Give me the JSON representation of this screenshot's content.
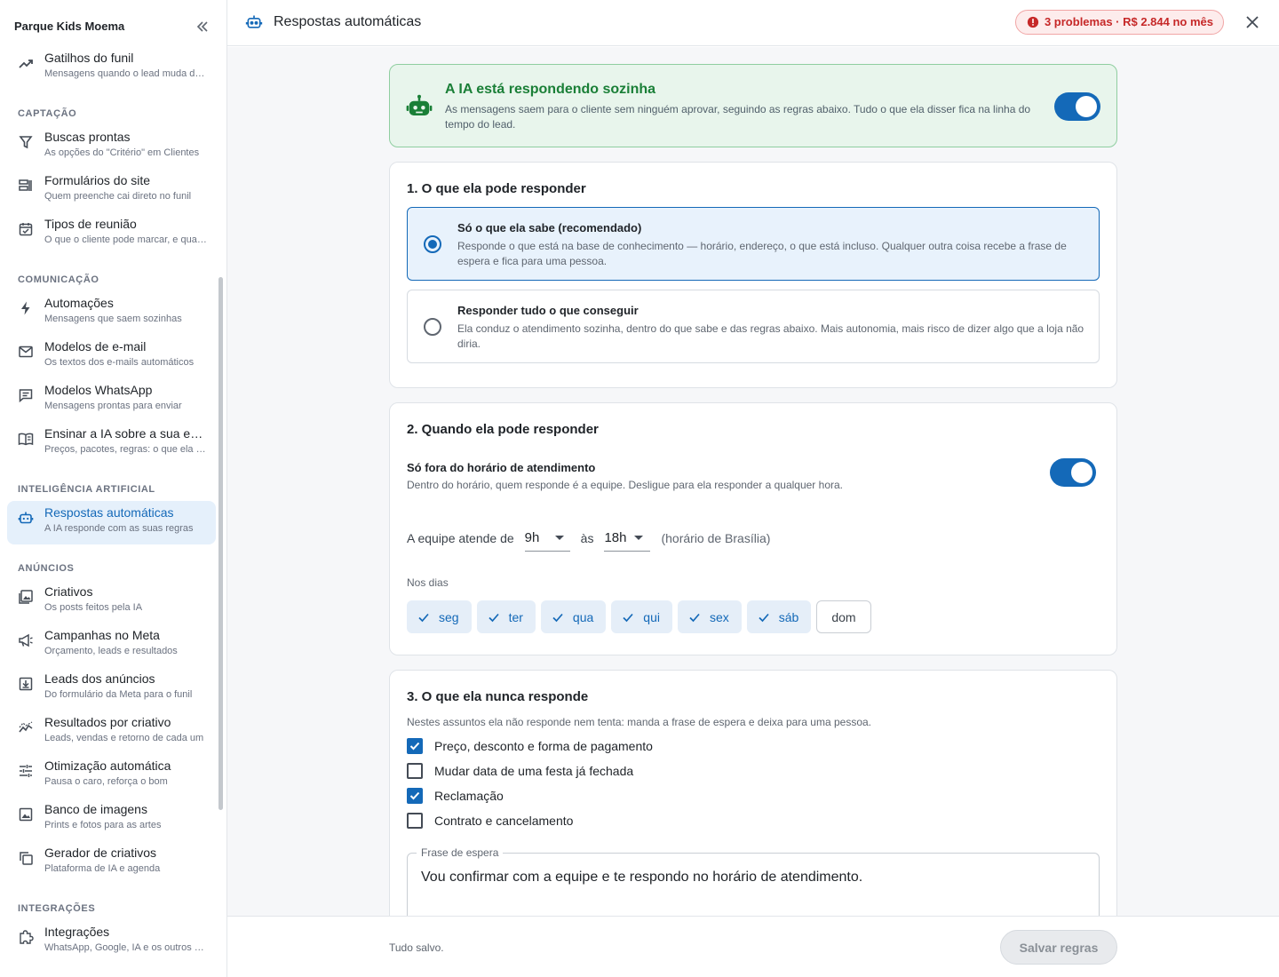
{
  "sidebar": {
    "org": "Parque Kids Moema",
    "items_top": [
      {
        "label": "Gatilhos do funil",
        "sub": "Mensagens quando o lead muda de etapa",
        "icon": "trending-icon"
      }
    ],
    "sections": [
      {
        "title": "CAPTAÇÃO",
        "items": [
          {
            "label": "Buscas prontas",
            "sub": "As opções do \"Critério\" em Clientes",
            "icon": "filter-icon"
          },
          {
            "label": "Formulários do site",
            "sub": "Quem preenche cai direto no funil",
            "icon": "form-icon"
          },
          {
            "label": "Tipos de reunião",
            "sub": "O que o cliente pode marcar, e quando",
            "icon": "calendar-icon"
          }
        ]
      },
      {
        "title": "COMUNICAÇÃO",
        "items": [
          {
            "label": "Automações",
            "sub": "Mensagens que saem sozinhas",
            "icon": "bolt-icon"
          },
          {
            "label": "Modelos de e-mail",
            "sub": "Os textos dos e-mails automáticos",
            "icon": "mail-icon"
          },
          {
            "label": "Modelos WhatsApp",
            "sub": "Mensagens prontas para enviar",
            "icon": "chat-icon"
          },
          {
            "label": "Ensinar a IA sobre a sua empresa",
            "sub": "Preços, pacotes, regras: o que ela precisa saber",
            "icon": "book-icon"
          }
        ]
      },
      {
        "title": "INTELIGÊNCIA ARTIFICIAL",
        "items": [
          {
            "label": "Respostas automáticas",
            "sub": "A IA responde com as suas regras",
            "icon": "robot-icon",
            "active": true
          }
        ]
      },
      {
        "title": "ANÚNCIOS",
        "items": [
          {
            "label": "Criativos",
            "sub": "Os posts feitos pela IA",
            "icon": "gallery-icon"
          },
          {
            "label": "Campanhas no Meta",
            "sub": "Orçamento, leads e resultados",
            "icon": "megaphone-icon"
          },
          {
            "label": "Leads dos anúncios",
            "sub": "Do formulário da Meta para o funil",
            "icon": "download-icon"
          },
          {
            "label": "Resultados por criativo",
            "sub": "Leads, vendas e retorno de cada um",
            "icon": "chart-line-icon"
          },
          {
            "label": "Otimização automática",
            "sub": "Pausa o caro, reforça o bom",
            "icon": "tune-icon"
          },
          {
            "label": "Banco de imagens",
            "sub": "Prints e fotos para as artes",
            "icon": "image-icon"
          },
          {
            "label": "Gerador de criativos",
            "sub": "Plataforma de IA e agenda",
            "icon": "copy-icon"
          }
        ]
      },
      {
        "title": "INTEGRAÇÕES",
        "items": [
          {
            "label": "Integrações",
            "sub": "WhatsApp, Google, IA e os outros serviços",
            "icon": "puzzle-icon"
          }
        ]
      }
    ]
  },
  "header": {
    "title": "Respostas automáticas",
    "problems": "3 problemas · R$ 2.844 no mês"
  },
  "banner": {
    "title": "A IA está respondendo sozinha",
    "desc": "As mensagens saem para o cliente sem ninguém aprovar, seguindo as regras abaixo. Tudo o que ela disser fica na linha do tempo do lead.",
    "enabled": true
  },
  "card1": {
    "title": "1. O que ela pode responder",
    "options": [
      {
        "title": "Só o que ela sabe (recomendado)",
        "desc": "Responde o que está na base de conhecimento — horário, endereço, o que está incluso. Qualquer outra coisa recebe a frase de espera e fica para uma pessoa.",
        "selected": true
      },
      {
        "title": "Responder tudo o que conseguir",
        "desc": "Ela conduz o atendimento sozinha, dentro do que sabe e das regras abaixo. Mais autonomia, mais risco de dizer algo que a loja não diria.",
        "selected": false
      }
    ]
  },
  "card2": {
    "title": "2. Quando ela pode responder",
    "toggle_title": "Só fora do horário de atendimento",
    "toggle_desc": "Dentro do horário, quem responde é a equipe. Desligue para ela responder a qualquer hora.",
    "toggle_on": true,
    "hours_prefix": "A equipe atende de",
    "from": "9h",
    "between": "às",
    "to": "18h",
    "tz": "(horário de Brasília)",
    "days_label": "Nos dias",
    "days": [
      {
        "label": "seg",
        "on": true
      },
      {
        "label": "ter",
        "on": true
      },
      {
        "label": "qua",
        "on": true
      },
      {
        "label": "qui",
        "on": true
      },
      {
        "label": "sex",
        "on": true
      },
      {
        "label": "sáb",
        "on": true
      },
      {
        "label": "dom",
        "on": false
      }
    ]
  },
  "card3": {
    "title": "3. O que ela nunca responde",
    "desc": "Nestes assuntos ela não responde nem tenta: manda a frase de espera e deixa para uma pessoa.",
    "items": [
      {
        "label": "Preço, desconto e forma de pagamento",
        "checked": true
      },
      {
        "label": "Mudar data de uma festa já fechada",
        "checked": false
      },
      {
        "label": "Reclamação",
        "checked": true
      },
      {
        "label": "Contrato e cancelamento",
        "checked": false
      }
    ],
    "field_label": "Frase de espera",
    "field_value": "Vou confirmar com a equipe e te respondo no horário de atendimento."
  },
  "footer": {
    "status": "Tudo salvo.",
    "save_label": "Salvar regras"
  },
  "colors": {
    "accent": "#1469b8",
    "success": "#1a7f37",
    "danger": "#c62828"
  }
}
